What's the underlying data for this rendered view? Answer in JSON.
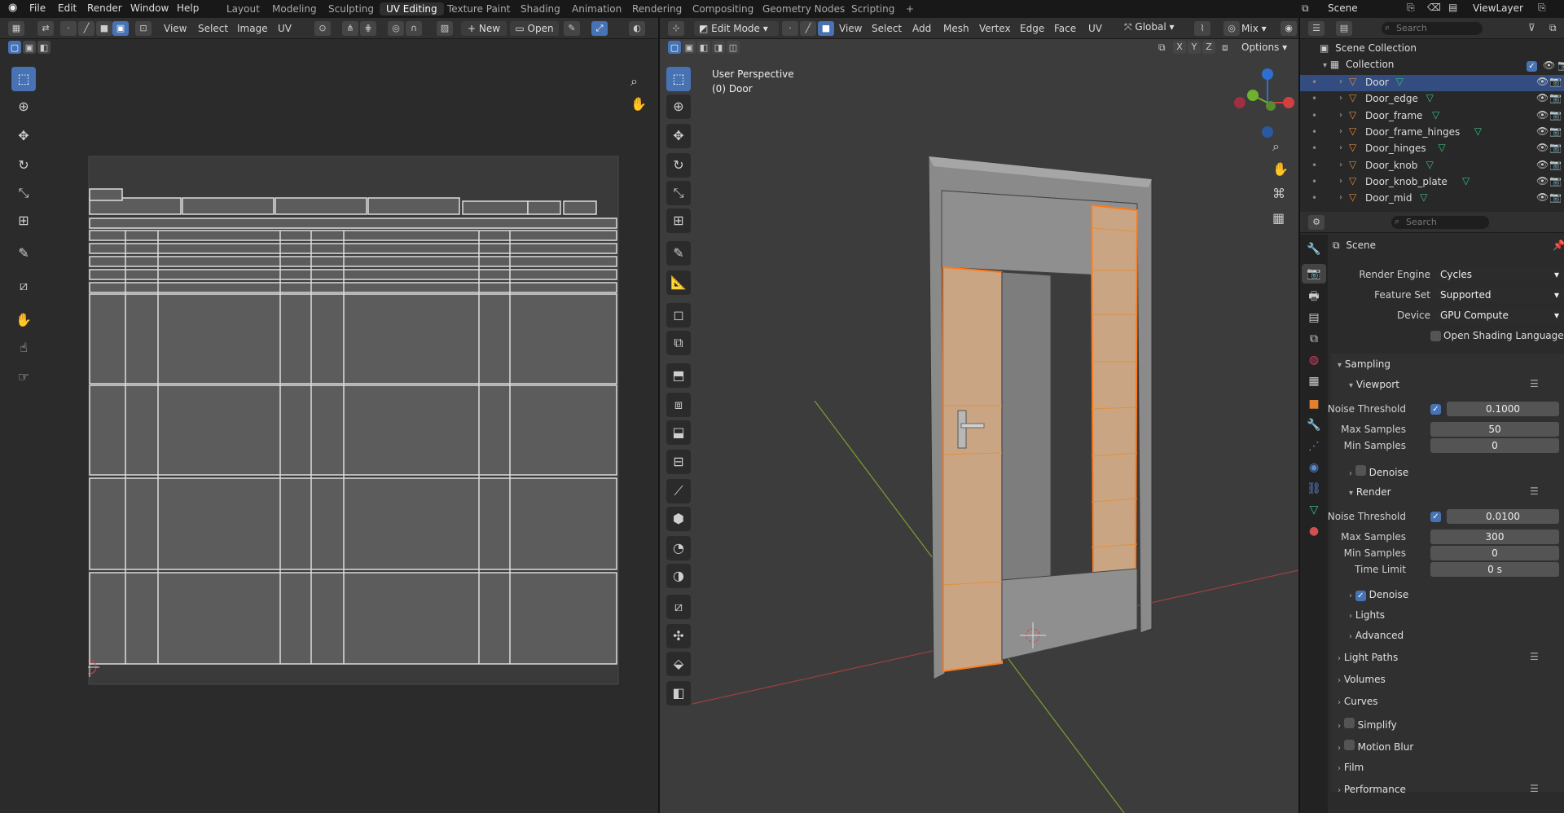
{
  "menu": [
    "File",
    "Edit",
    "Render",
    "Window",
    "Help"
  ],
  "workspaces": [
    "Layout",
    "Modeling",
    "Sculpting",
    "UV Editing",
    "Texture Paint",
    "Shading",
    "Animation",
    "Rendering",
    "Compositing",
    "Geometry Nodes",
    "Scripting",
    "+"
  ],
  "active_workspace": "UV Editing",
  "scene_label": "Scene",
  "viewlayer_label": "ViewLayer",
  "uv_header": {
    "view": "View",
    "select": "Select",
    "image": "Image",
    "uv": "UV",
    "new": "New",
    "open": "Open"
  },
  "vp_header": {
    "mode": "Edit Mode",
    "view": "View",
    "select": "Select",
    "add": "Add",
    "mesh": "Mesh",
    "vertex": "Vertex",
    "edge": "Edge",
    "face": "Face",
    "uv": "UV",
    "orientation": "Global",
    "shading": "Mix",
    "options": "Options",
    "axes": [
      "X",
      "Y",
      "Z"
    ]
  },
  "viewport": {
    "perspective": "User Perspective",
    "object": "(0) Door"
  },
  "outliner": {
    "search_placeholder": "Search",
    "collection_root": "Scene Collection",
    "collection": "Collection",
    "items": [
      "Door",
      "Door_edge",
      "Door_frame",
      "Door_frame_hinges",
      "Door_hinges",
      "Door_knob",
      "Door_knob_plate",
      "Door_mid"
    ]
  },
  "props": {
    "search_placeholder": "Search",
    "breadcrumb": "Scene",
    "render_engine_label": "Render Engine",
    "render_engine": "Cycles",
    "feature_set_label": "Feature Set",
    "feature_set": "Supported",
    "device_label": "Device",
    "device": "GPU Compute",
    "osl_label": "Open Shading Language",
    "sampling": "Sampling",
    "viewport": "Viewport",
    "noise_threshold_label": "Noise Threshold",
    "vp_noise": "0.1000",
    "max_samples_label": "Max Samples",
    "vp_max": "50",
    "min_samples_label": "Min Samples",
    "vp_min": "0",
    "denoise": "Denoise",
    "render": "Render",
    "r_noise": "0.0100",
    "r_max": "300",
    "r_min": "0",
    "time_limit_label": "Time Limit",
    "r_time": "0 s",
    "lights": "Lights",
    "advanced": "Advanced",
    "panels": [
      "Light Paths",
      "Volumes",
      "Curves",
      "Simplify",
      "Motion Blur",
      "Film",
      "Performance"
    ]
  },
  "colors": {
    "accent": "#4772b3",
    "selected_face": "#e0a070",
    "selected_edge": "#ff7a1a"
  }
}
